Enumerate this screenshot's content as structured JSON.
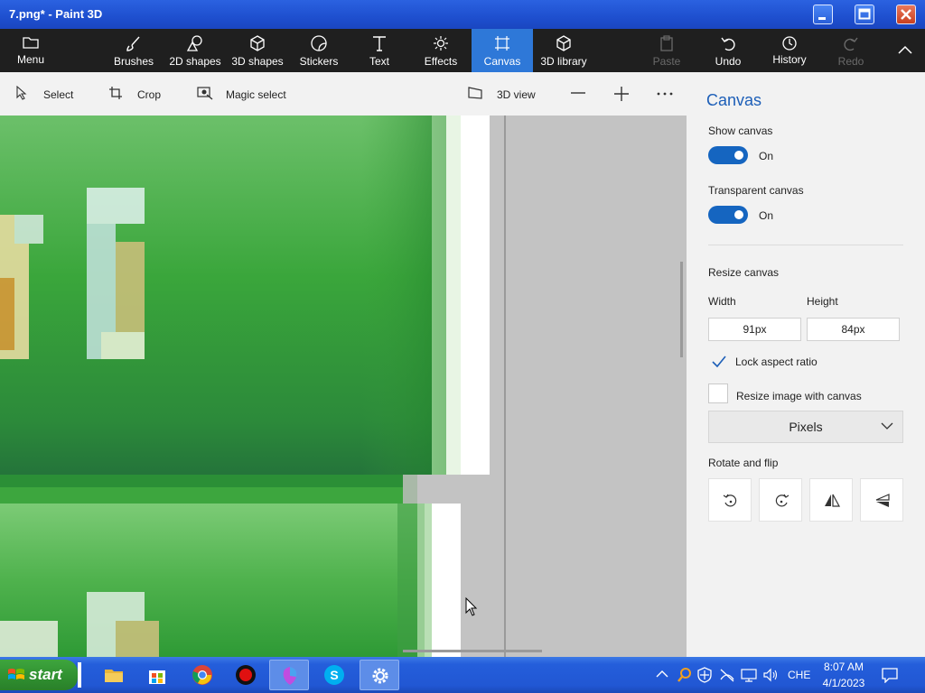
{
  "window": {
    "title": "7.png* - Paint 3D"
  },
  "ribbon": {
    "menu_label": "Menu",
    "tabs": [
      {
        "label": "Brushes",
        "icon": "brush-icon"
      },
      {
        "label": "2D shapes",
        "icon": "2d-shapes-icon"
      },
      {
        "label": "3D shapes",
        "icon": "3d-shapes-icon"
      },
      {
        "label": "Stickers",
        "icon": "stickers-icon"
      },
      {
        "label": "Text",
        "icon": "text-icon"
      },
      {
        "label": "Effects",
        "icon": "effects-icon"
      },
      {
        "label": "Canvas",
        "icon": "canvas-icon",
        "active": true
      },
      {
        "label": "3D library",
        "icon": "3d-library-icon"
      }
    ],
    "paste_label": "Paste",
    "undo_label": "Undo",
    "history_label": "History",
    "redo_label": "Redo"
  },
  "toolbar": {
    "select_label": "Select",
    "crop_label": "Crop",
    "magic_select_label": "Magic select",
    "view3d_label": "3D view"
  },
  "panel": {
    "title": "Canvas",
    "show_canvas_label": "Show canvas",
    "show_canvas_state": "On",
    "transparent_canvas_label": "Transparent canvas",
    "transparent_canvas_state": "On",
    "resize_canvas_label": "Resize canvas",
    "width_label": "Width",
    "height_label": "Height",
    "width_value": "91px",
    "height_value": "84px",
    "lock_aspect_label": "Lock aspect ratio",
    "lock_aspect_checked": true,
    "resize_image_label": "Resize image with canvas",
    "resize_image_checked": false,
    "units_selected": "Pixels",
    "rotate_flip_label": "Rotate and flip"
  },
  "taskbar": {
    "start_label": "start",
    "language": "CHE",
    "time": "8:07 AM",
    "date": "4/1/2023"
  },
  "colors": {
    "accent": "#2e78d8",
    "toggle_on": "#1565c0",
    "panel_title": "#1d5fb8",
    "canvas_green": "#3fa540",
    "taskbar_blue": "#245edb"
  }
}
